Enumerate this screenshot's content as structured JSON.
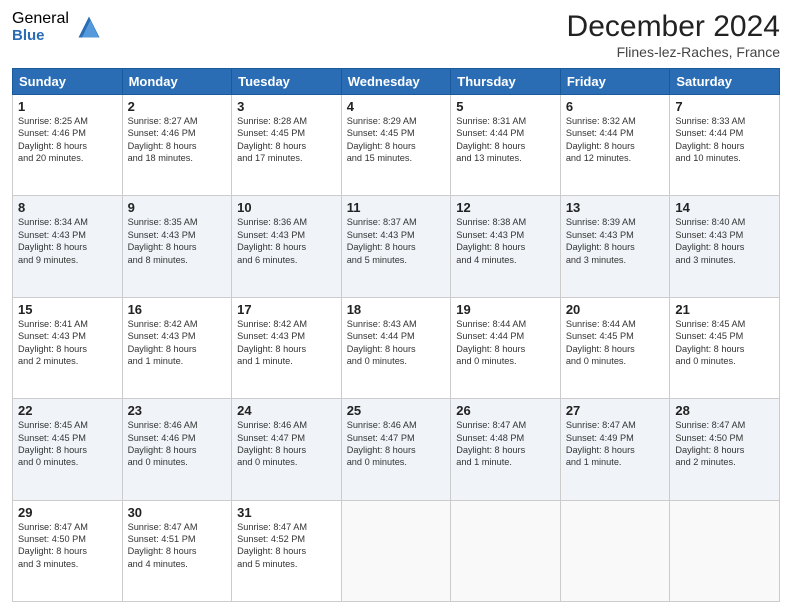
{
  "header": {
    "logo_general": "General",
    "logo_blue": "Blue",
    "month_title": "December 2024",
    "location": "Flines-lez-Raches, France"
  },
  "days_of_week": [
    "Sunday",
    "Monday",
    "Tuesday",
    "Wednesday",
    "Thursday",
    "Friday",
    "Saturday"
  ],
  "weeks": [
    [
      {
        "day": "1",
        "lines": [
          "Sunrise: 8:25 AM",
          "Sunset: 4:46 PM",
          "Daylight: 8 hours",
          "and 20 minutes."
        ]
      },
      {
        "day": "2",
        "lines": [
          "Sunrise: 8:27 AM",
          "Sunset: 4:46 PM",
          "Daylight: 8 hours",
          "and 18 minutes."
        ]
      },
      {
        "day": "3",
        "lines": [
          "Sunrise: 8:28 AM",
          "Sunset: 4:45 PM",
          "Daylight: 8 hours",
          "and 17 minutes."
        ]
      },
      {
        "day": "4",
        "lines": [
          "Sunrise: 8:29 AM",
          "Sunset: 4:45 PM",
          "Daylight: 8 hours",
          "and 15 minutes."
        ]
      },
      {
        "day": "5",
        "lines": [
          "Sunrise: 8:31 AM",
          "Sunset: 4:44 PM",
          "Daylight: 8 hours",
          "and 13 minutes."
        ]
      },
      {
        "day": "6",
        "lines": [
          "Sunrise: 8:32 AM",
          "Sunset: 4:44 PM",
          "Daylight: 8 hours",
          "and 12 minutes."
        ]
      },
      {
        "day": "7",
        "lines": [
          "Sunrise: 8:33 AM",
          "Sunset: 4:44 PM",
          "Daylight: 8 hours",
          "and 10 minutes."
        ]
      }
    ],
    [
      {
        "day": "8",
        "lines": [
          "Sunrise: 8:34 AM",
          "Sunset: 4:43 PM",
          "Daylight: 8 hours",
          "and 9 minutes."
        ]
      },
      {
        "day": "9",
        "lines": [
          "Sunrise: 8:35 AM",
          "Sunset: 4:43 PM",
          "Daylight: 8 hours",
          "and 8 minutes."
        ]
      },
      {
        "day": "10",
        "lines": [
          "Sunrise: 8:36 AM",
          "Sunset: 4:43 PM",
          "Daylight: 8 hours",
          "and 6 minutes."
        ]
      },
      {
        "day": "11",
        "lines": [
          "Sunrise: 8:37 AM",
          "Sunset: 4:43 PM",
          "Daylight: 8 hours",
          "and 5 minutes."
        ]
      },
      {
        "day": "12",
        "lines": [
          "Sunrise: 8:38 AM",
          "Sunset: 4:43 PM",
          "Daylight: 8 hours",
          "and 4 minutes."
        ]
      },
      {
        "day": "13",
        "lines": [
          "Sunrise: 8:39 AM",
          "Sunset: 4:43 PM",
          "Daylight: 8 hours",
          "and 3 minutes."
        ]
      },
      {
        "day": "14",
        "lines": [
          "Sunrise: 8:40 AM",
          "Sunset: 4:43 PM",
          "Daylight: 8 hours",
          "and 3 minutes."
        ]
      }
    ],
    [
      {
        "day": "15",
        "lines": [
          "Sunrise: 8:41 AM",
          "Sunset: 4:43 PM",
          "Daylight: 8 hours",
          "and 2 minutes."
        ]
      },
      {
        "day": "16",
        "lines": [
          "Sunrise: 8:42 AM",
          "Sunset: 4:43 PM",
          "Daylight: 8 hours",
          "and 1 minute."
        ]
      },
      {
        "day": "17",
        "lines": [
          "Sunrise: 8:42 AM",
          "Sunset: 4:43 PM",
          "Daylight: 8 hours",
          "and 1 minute."
        ]
      },
      {
        "day": "18",
        "lines": [
          "Sunrise: 8:43 AM",
          "Sunset: 4:44 PM",
          "Daylight: 8 hours",
          "and 0 minutes."
        ]
      },
      {
        "day": "19",
        "lines": [
          "Sunrise: 8:44 AM",
          "Sunset: 4:44 PM",
          "Daylight: 8 hours",
          "and 0 minutes."
        ]
      },
      {
        "day": "20",
        "lines": [
          "Sunrise: 8:44 AM",
          "Sunset: 4:45 PM",
          "Daylight: 8 hours",
          "and 0 minutes."
        ]
      },
      {
        "day": "21",
        "lines": [
          "Sunrise: 8:45 AM",
          "Sunset: 4:45 PM",
          "Daylight: 8 hours",
          "and 0 minutes."
        ]
      }
    ],
    [
      {
        "day": "22",
        "lines": [
          "Sunrise: 8:45 AM",
          "Sunset: 4:45 PM",
          "Daylight: 8 hours",
          "and 0 minutes."
        ]
      },
      {
        "day": "23",
        "lines": [
          "Sunrise: 8:46 AM",
          "Sunset: 4:46 PM",
          "Daylight: 8 hours",
          "and 0 minutes."
        ]
      },
      {
        "day": "24",
        "lines": [
          "Sunrise: 8:46 AM",
          "Sunset: 4:47 PM",
          "Daylight: 8 hours",
          "and 0 minutes."
        ]
      },
      {
        "day": "25",
        "lines": [
          "Sunrise: 8:46 AM",
          "Sunset: 4:47 PM",
          "Daylight: 8 hours",
          "and 0 minutes."
        ]
      },
      {
        "day": "26",
        "lines": [
          "Sunrise: 8:47 AM",
          "Sunset: 4:48 PM",
          "Daylight: 8 hours",
          "and 1 minute."
        ]
      },
      {
        "day": "27",
        "lines": [
          "Sunrise: 8:47 AM",
          "Sunset: 4:49 PM",
          "Daylight: 8 hours",
          "and 1 minute."
        ]
      },
      {
        "day": "28",
        "lines": [
          "Sunrise: 8:47 AM",
          "Sunset: 4:50 PM",
          "Daylight: 8 hours",
          "and 2 minutes."
        ]
      }
    ],
    [
      {
        "day": "29",
        "lines": [
          "Sunrise: 8:47 AM",
          "Sunset: 4:50 PM",
          "Daylight: 8 hours",
          "and 3 minutes."
        ]
      },
      {
        "day": "30",
        "lines": [
          "Sunrise: 8:47 AM",
          "Sunset: 4:51 PM",
          "Daylight: 8 hours",
          "and 4 minutes."
        ]
      },
      {
        "day": "31",
        "lines": [
          "Sunrise: 8:47 AM",
          "Sunset: 4:52 PM",
          "Daylight: 8 hours",
          "and 5 minutes."
        ]
      },
      null,
      null,
      null,
      null
    ]
  ]
}
